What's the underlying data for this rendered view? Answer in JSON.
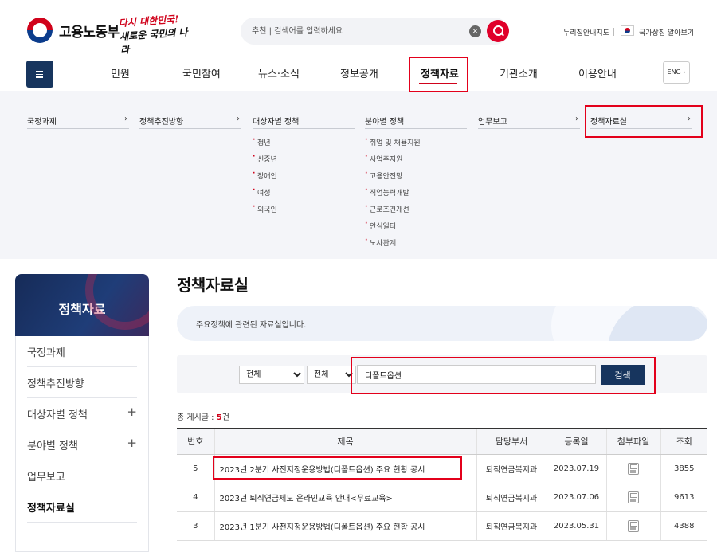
{
  "header": {
    "logo_name": "고용노동부",
    "slogan_line1": "다시 대한민국!",
    "slogan_line2": "새로운 국민의 나라",
    "search_placeholder": "추천 | 검색어를 입력하세요",
    "util_sitemap": "누리집안내지도",
    "util_symbol": "국가상징 알아보기"
  },
  "gnb": {
    "items": [
      "민원",
      "국민참여",
      "뉴스·소식",
      "정보공개",
      "정책자료",
      "기관소개",
      "이용안내"
    ],
    "active": "정책자료",
    "lang": "ENG"
  },
  "mega_menu": [
    {
      "label": "국정과제",
      "sub": []
    },
    {
      "label": "정책추진방향",
      "sub": []
    },
    {
      "label": "대상자별 정책",
      "sub": [
        "청년",
        "신중년",
        "장애인",
        "여성",
        "외국인"
      ]
    },
    {
      "label": "분야별 정책",
      "sub": [
        "취업 및 채용지원",
        "사업주지원",
        "고용안전망",
        "직업능력개발",
        "근로조건개선",
        "안심일터",
        "노사관계"
      ]
    },
    {
      "label": "업무보고",
      "sub": []
    },
    {
      "label": "정책자료실",
      "sub": []
    }
  ],
  "lnb": {
    "title": "정책자료",
    "items": [
      "국정과제",
      "정책추진방향",
      "대상자별 정책",
      "분야별 정책",
      "업무보고",
      "정책자료실"
    ]
  },
  "content": {
    "title": "정책자료실",
    "description": "주요정책에 관련된 자료실입니다.",
    "search": {
      "select1": "전체",
      "select2": "전체",
      "keyword": "디폴트옵션",
      "button": "검색"
    },
    "total_label": "총 게시글 : ",
    "total_count": "5",
    "total_unit": "건",
    "columns": [
      "번호",
      "제목",
      "담당부서",
      "등록일",
      "첨부파일",
      "조회"
    ],
    "rows": [
      {
        "no": "5",
        "title": "2023년 2분기 사전지정운용방법(디폴트옵션) 주요 현황 공시",
        "dept": "퇴직연금복지과",
        "date": "2023.07.19",
        "views": "3855"
      },
      {
        "no": "4",
        "title": "2023년 퇴직연금제도 온라인교육 안내<무료교육>",
        "dept": "퇴직연금복지과",
        "date": "2023.07.06",
        "views": "9613"
      },
      {
        "no": "3",
        "title": "2023년 1분기 사전지정운용방법(디폴트옵션) 주요 현황 공시",
        "dept": "퇴직연금복지과",
        "date": "2023.05.31",
        "views": "4388"
      }
    ]
  },
  "colors": {
    "navy": "#17355e",
    "highlight": "#e3001b",
    "accent_red": "#d0021b"
  }
}
